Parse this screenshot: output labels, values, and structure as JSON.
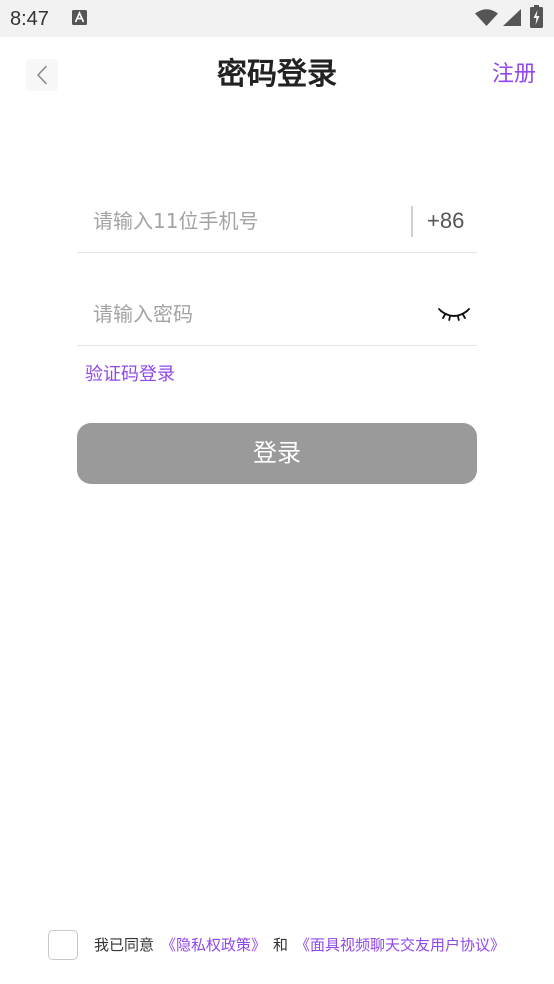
{
  "status_bar": {
    "time": "8:47",
    "icons": [
      "app-notification-icon",
      "wifi-icon",
      "cell-signal-icon",
      "battery-charging-icon"
    ]
  },
  "header": {
    "back_icon": "chevron-left-icon",
    "title": "密码登录",
    "register_label": "注册"
  },
  "login_form": {
    "phone_field": {
      "value": "",
      "placeholder": "请输入11位手机号"
    },
    "country_code": "+86",
    "password_field": {
      "value": "",
      "placeholder": "请输入密码"
    },
    "password_visibility_icon": "eye-closed-icon",
    "sms_login_label": "验证码登录",
    "submit_label": "登录",
    "submit_enabled": false
  },
  "agreement": {
    "checked": false,
    "prefix": "我已同意",
    "privacy_link": "《隐私权政策》",
    "conjunction": "和",
    "terms_link": "《面具视频聊天交友用户协议》"
  },
  "colors": {
    "accent": "#9148ea",
    "button_disabled": "#9a9a9a",
    "placeholder": "#a3a3a3",
    "status_bar_bg": "#f2f2f2"
  }
}
